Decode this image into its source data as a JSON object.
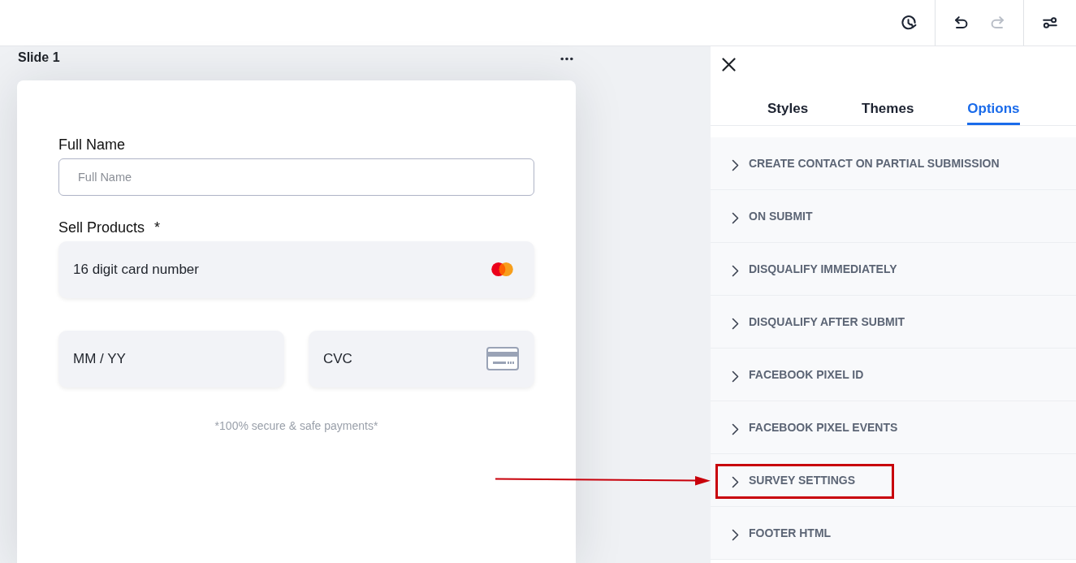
{
  "toolbar": {
    "groups": [
      {
        "buttons": [
          {
            "kind": "history",
            "disabled": false
          }
        ]
      },
      {
        "buttons": [
          {
            "kind": "undo",
            "disabled": false
          },
          {
            "kind": "redo",
            "disabled": true
          }
        ]
      },
      {
        "buttons": [
          {
            "kind": "settings",
            "disabled": false
          }
        ]
      }
    ]
  },
  "slide": {
    "title": "Slide 1",
    "form": {
      "full_name": {
        "label": "Full Name",
        "placeholder": "Full Name"
      },
      "payment": {
        "label": "Sell Products",
        "required_mark": "*",
        "card_number": {
          "placeholder": "16 digit card number"
        },
        "expiry": {
          "placeholder": "MM / YY"
        },
        "cvc": {
          "placeholder": "CVC"
        },
        "note": "*100% secure & safe payments*"
      }
    }
  },
  "panel": {
    "tabs": [
      {
        "label": "Styles",
        "selected": false
      },
      {
        "label": "Themes",
        "selected": false
      },
      {
        "label": "Options",
        "selected": true
      }
    ],
    "options": [
      {
        "label": "CREATE CONTACT ON PARTIAL SUBMISSION",
        "expanded": false,
        "highlighted": false
      },
      {
        "label": "ON SUBMIT",
        "expanded": false,
        "highlighted": false
      },
      {
        "label": "DISQUALIFY IMMEDIATELY",
        "expanded": false,
        "highlighted": false
      },
      {
        "label": "DISQUALIFY AFTER SUBMIT",
        "expanded": false,
        "highlighted": false
      },
      {
        "label": "FACEBOOK PIXEL ID",
        "expanded": false,
        "highlighted": false
      },
      {
        "label": "FACEBOOK PIXEL EVENTS",
        "expanded": false,
        "highlighted": false
      },
      {
        "label": "SURVEY SETTINGS",
        "expanded": false,
        "highlighted": true
      },
      {
        "label": "FOOTER HTML",
        "expanded": false,
        "highlighted": false
      }
    ]
  }
}
